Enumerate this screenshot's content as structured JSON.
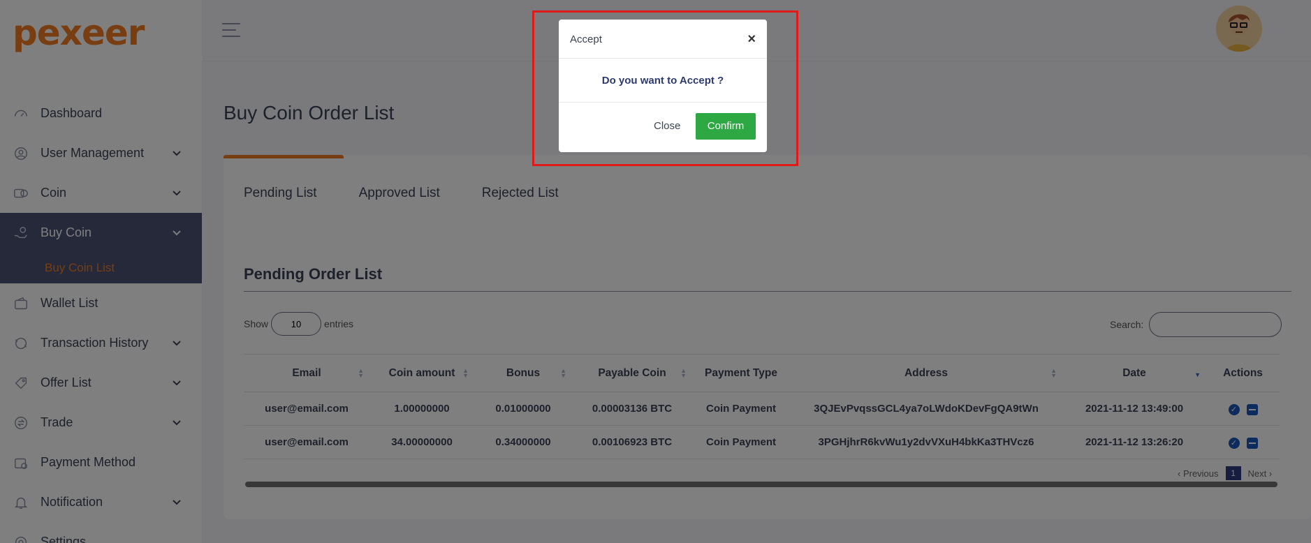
{
  "brand": {
    "logo_text": "pexeer",
    "accent": "#f07d22"
  },
  "sidebar": {
    "items": [
      {
        "label": "Dashboard",
        "icon": "dashboard-icon",
        "has_submenu": false
      },
      {
        "label": "User Management",
        "icon": "user-icon",
        "has_submenu": true
      },
      {
        "label": "Coin",
        "icon": "coin-icon",
        "has_submenu": true
      },
      {
        "label": "Buy Coin",
        "icon": "buy-coin-icon",
        "has_submenu": true,
        "active": true,
        "subitems": [
          "Buy Coin List"
        ]
      },
      {
        "label": "Wallet List",
        "icon": "wallet-icon",
        "has_submenu": false
      },
      {
        "label": "Transaction History",
        "icon": "transaction-icon",
        "has_submenu": true
      },
      {
        "label": "Offer List",
        "icon": "offer-icon",
        "has_submenu": true
      },
      {
        "label": "Trade",
        "icon": "trade-icon",
        "has_submenu": true
      },
      {
        "label": "Payment Method",
        "icon": "payment-icon",
        "has_submenu": false
      },
      {
        "label": "Notification",
        "icon": "bell-icon",
        "has_submenu": true
      },
      {
        "label": "Settings",
        "icon": "settings-icon",
        "has_submenu": true
      }
    ]
  },
  "page": {
    "title": "Buy Coin Order List"
  },
  "tabs": [
    "Pending List",
    "Approved List",
    "Rejected List"
  ],
  "section": {
    "title": "Pending Order List"
  },
  "controls": {
    "show_label": "Show",
    "entries_value": "10",
    "entries_label": "entries",
    "search_label": "Search:"
  },
  "table": {
    "columns": [
      "Email",
      "Coin amount",
      "Bonus",
      "Payable Coin",
      "Payment Type",
      "Address",
      "Date",
      "Actions"
    ],
    "rows": [
      [
        "user@email.com",
        "1.00000000",
        "0.01000000",
        "0.00003136 BTC",
        "Coin Payment",
        "3QJEvPvqssGCL4ya7oLWdoKDevFgQA9tWn",
        "2021-11-12 13:49:00"
      ],
      [
        "user@email.com",
        "34.00000000",
        "0.34000000",
        "0.00106923 BTC",
        "Coin Payment",
        "3PGHjhrR6kvWu1y2dvVXuH4bkKa3THVcz6",
        "2021-11-12 13:26:20"
      ]
    ]
  },
  "pagination": {
    "previous": "‹ Previous",
    "current": "1",
    "next": "Next ›"
  },
  "modal": {
    "title": "Accept",
    "close_symbol": "×",
    "message": "Do you want to Accept ?",
    "close_label": "Close",
    "confirm_label": "Confirm",
    "confirm_color": "#2da843"
  }
}
